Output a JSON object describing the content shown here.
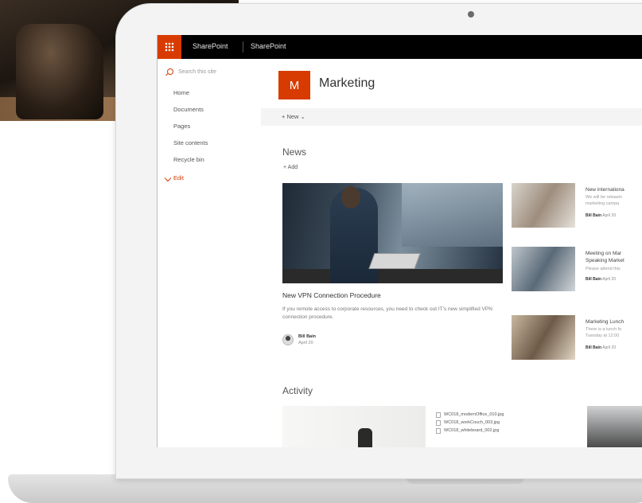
{
  "suite": {
    "app_name": "SharePoint",
    "site_name": "SharePoint"
  },
  "nav": {
    "search_placeholder": "Search this site",
    "items": [
      "Home",
      "Documents",
      "Pages",
      "Site contents",
      "Recycle bin"
    ],
    "edit_label": "Edit"
  },
  "site": {
    "logo_letter": "M",
    "title": "Marketing",
    "new_label": "+ New ⌄"
  },
  "news": {
    "title": "News",
    "add_label": "+ Add",
    "hero": {
      "headline": "New VPN Connection Procedure",
      "description": "If you remote access to corporate resources, you need to check out IT's new simplified VPN connection procedure.",
      "author": "Bill Bain",
      "date": "April 20"
    },
    "side_items": [
      {
        "title": "New internationa",
        "desc_line1": "We will be releasin",
        "desc_line2": "marketing campa",
        "author": "Bill Bain",
        "date": "April 20"
      },
      {
        "title": "Meeting on Mar",
        "title_line2": "Speaking Market",
        "desc_line1": "Please attend this",
        "author": "Bill Bain",
        "date": "April 20"
      },
      {
        "title": "Marketing Lunch",
        "desc_line1": "There is a lunch fo",
        "desc_line2": "Tuesday at 12:00",
        "author": "Bill Bain",
        "date": "April 20"
      }
    ]
  },
  "activity": {
    "title": "Activity",
    "files": [
      "WC018_modernOffice_010.jpg",
      "WC018_workCouch_003.jpg",
      "WC018_whiteboard_002.jpg"
    ]
  },
  "colors": {
    "accent": "#d83b01",
    "suitebar": "#000000"
  }
}
